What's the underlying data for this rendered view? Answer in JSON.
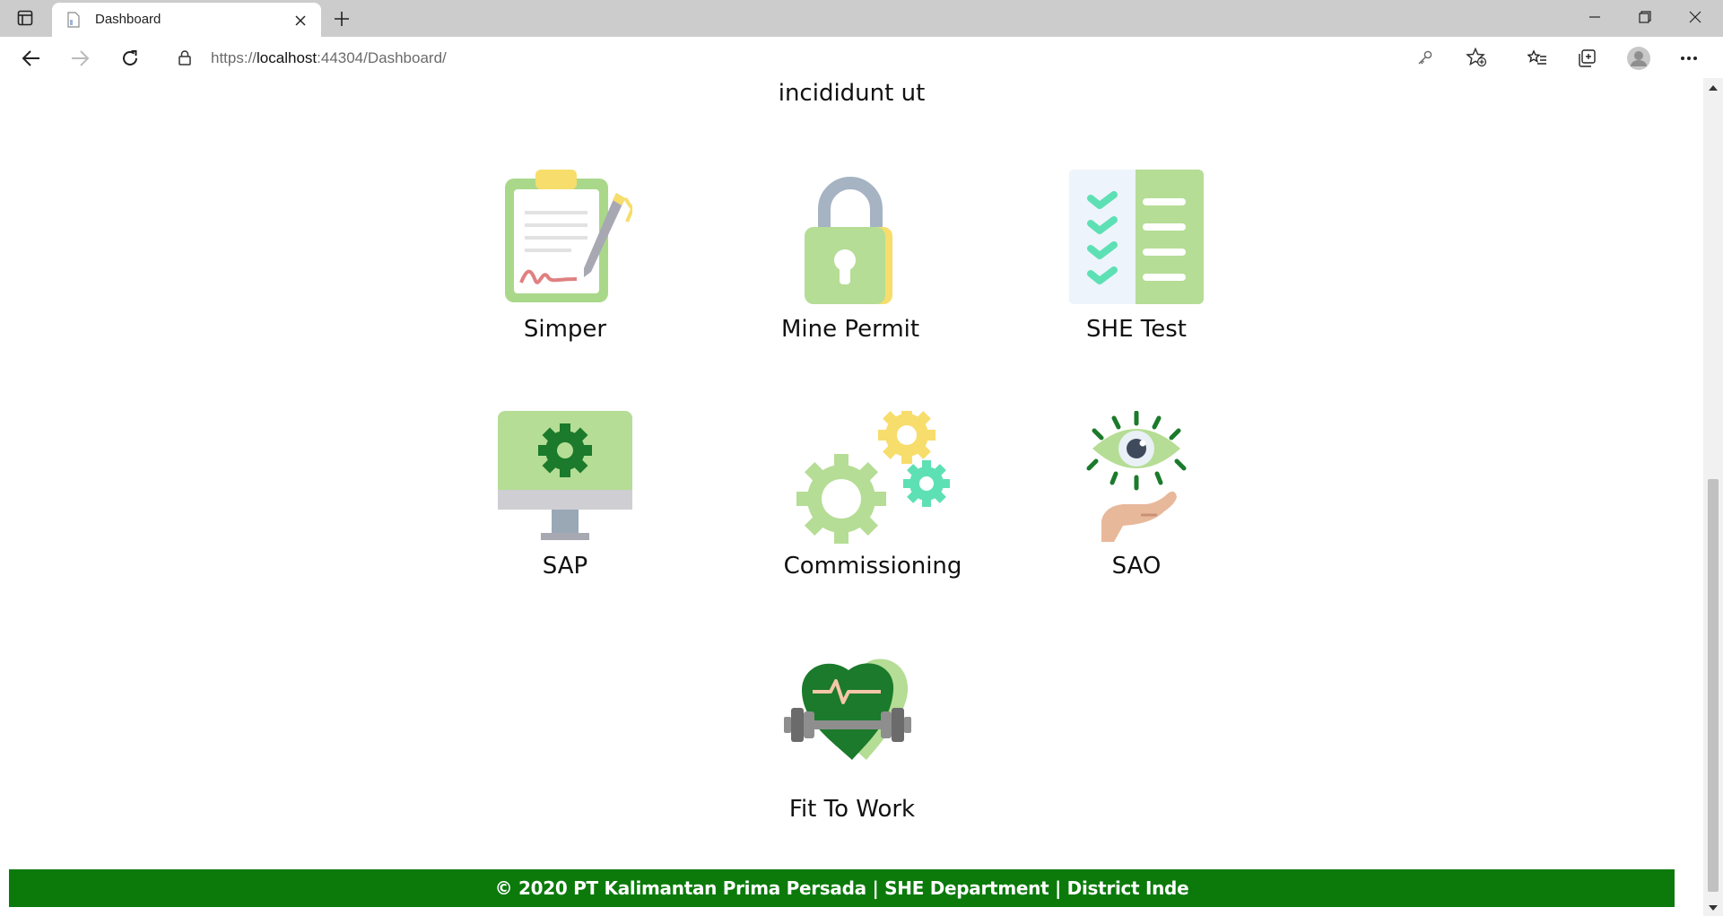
{
  "browser": {
    "tab_title": "Dashboard",
    "url_prefix": "https://",
    "url_host": "localhost",
    "url_rest": ":44304/Dashboard/"
  },
  "page": {
    "lead_text": "incididunt ut",
    "modules": [
      {
        "label": "Simper",
        "icon": "clipboard-signature-icon"
      },
      {
        "label": "Mine Permit",
        "icon": "padlock-icon"
      },
      {
        "label": "SHE Test",
        "icon": "checklist-icon"
      },
      {
        "label": "SAP",
        "icon": "monitor-gear-icon"
      },
      {
        "label": "Commissioning",
        "icon": "gears-icon"
      },
      {
        "label": "SAO",
        "icon": "eye-hand-icon"
      },
      {
        "label": "Fit To Work",
        "icon": "heart-dumbbell-icon"
      }
    ],
    "footer_text": "© 2020 PT Kalimantan Prima Persada | SHE Department | District Inde"
  },
  "colors": {
    "footer_bg": "#0b7a0b",
    "icon_green_light": "#b5dd95",
    "icon_green_dark": "#1b7a2b",
    "icon_yellow": "#f7dd6b",
    "icon_teal": "#5ee0b5"
  }
}
